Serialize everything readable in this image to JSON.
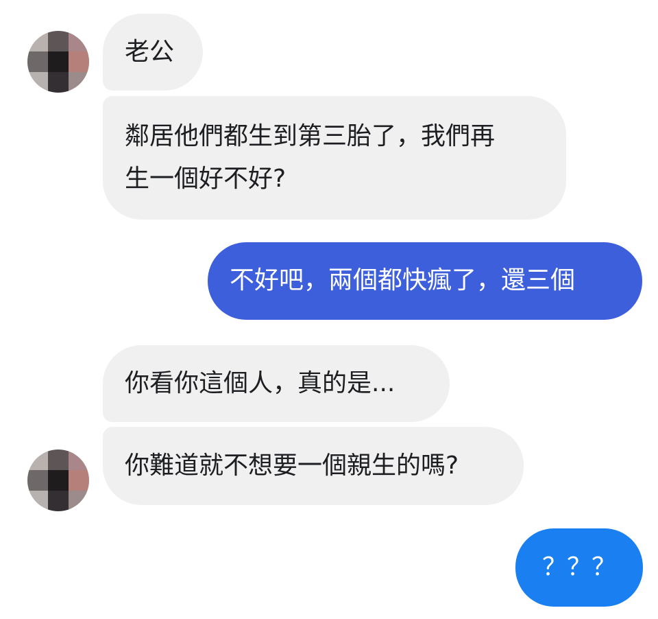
{
  "conversation": {
    "messages": [
      {
        "sender": "contact",
        "text": "老公"
      },
      {
        "sender": "contact",
        "text": "鄰居他們都生到第三胎了，我們再\n生一個好不好?"
      },
      {
        "sender": "me",
        "text": "不好吧，兩個都快瘋了，還三個"
      },
      {
        "sender": "contact",
        "text": "你看你這個人，真的是..."
      },
      {
        "sender": "contact",
        "text": "你難道就不想要一個親生的嗎?"
      },
      {
        "sender": "me",
        "text": "？？？"
      }
    ]
  },
  "colors": {
    "incoming_bubble": "#f0f0f0",
    "outgoing_bubble_primary": "#3e5fdc",
    "outgoing_bubble_secondary": "#1a7ff0",
    "incoming_text": "#1c1e21",
    "outgoing_text": "#ffffff"
  },
  "icons": {
    "contact_avatar": "blurred-profile-photo"
  }
}
